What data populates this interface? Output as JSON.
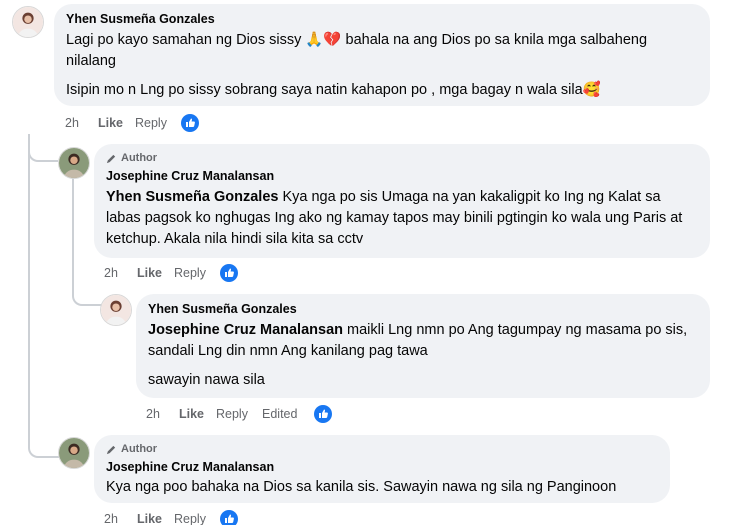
{
  "comments": [
    {
      "author": "Yhen Susmeña Gonzales",
      "author_badge": "",
      "paragraphs": [
        "Lagi po kayo samahan ng Dios sissy 🙏💔 bahala na ang Dios po sa knila mga salbaheng nilalang",
        "Isipin mo n Lng po sissy sobrang saya natin kahapon po , mga bagay n wala sila🥰"
      ],
      "time": "2h",
      "like": "Like",
      "reply": "Reply"
    },
    {
      "author": "Josephine Cruz Manalansan",
      "author_badge": "Author",
      "mention": "Yhen Susmeña Gonzales",
      "text": " Kya nga po sis Umaga na yan kakaligpit ko Ing ng Kalat sa labas pagsok ko nghugas Ing ako ng kamay tapos may binili pgtingin ko wala ung Paris at ketchup. Akala nila hindi sila kita sa cctv",
      "time": "2h",
      "like": "Like",
      "reply": "Reply"
    },
    {
      "author": "Yhen Susmeña Gonzales",
      "author_badge": "",
      "mention": "Josephine Cruz Manalansan",
      "text": " maikli Lng nmn po Ang tagumpay ng masama po sis, sandali Lng din nmn Ang kanilang pag tawa",
      "text2": "sawayin nawa sila",
      "time": "2h",
      "like": "Like",
      "reply": "Reply",
      "edited": "Edited"
    },
    {
      "author": "Josephine Cruz Manalansan",
      "author_badge": "Author",
      "text": "Kya nga poo bahaka na Dios sa kanila sis. Sawayin nawa ng sila ng Panginoon",
      "time": "2h",
      "like": "Like",
      "reply": "Reply"
    }
  ],
  "colors": {
    "bubble": "#f0f2f5",
    "meta": "#65676b",
    "like_blue": "#1877f2"
  },
  "icons": [
    "pencil-icon",
    "like-reaction-icon"
  ]
}
